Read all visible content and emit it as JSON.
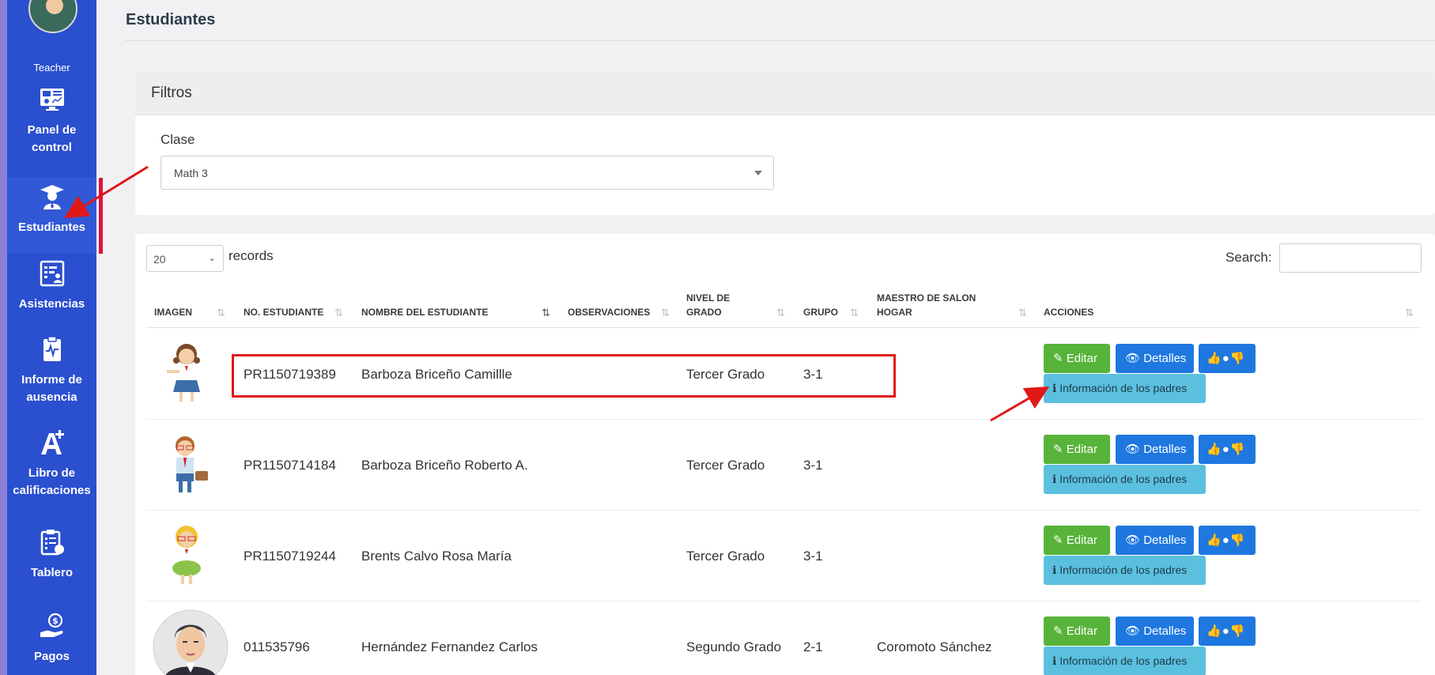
{
  "sidebar": {
    "items": [
      {
        "label": "Teacher",
        "icon": "teacher-avatar"
      },
      {
        "label": "Panel de control",
        "icon": "dashboard-monitor-icon"
      },
      {
        "label": "Estudiantes",
        "icon": "graduate-icon"
      },
      {
        "label": "Asistencias",
        "icon": "attendance-icon"
      },
      {
        "label": "Informe de ausencia",
        "icon": "clipboard-pulse-icon"
      },
      {
        "label": "Libro de calificaciones",
        "icon": "grade-a-plus-icon"
      },
      {
        "label": "Tablero",
        "icon": "board-clipboard-icon"
      },
      {
        "label": "Pagos",
        "icon": "payment-hand-icon"
      }
    ],
    "colors": {
      "background": "#2a4fcf",
      "active_bar": "#e0123a"
    }
  },
  "page": {
    "title": "Estudiantes"
  },
  "filters": {
    "heading": "Filtros",
    "clase_label": "Clase",
    "clase_value": "Math 3"
  },
  "table": {
    "page_length": "20",
    "records_label": "records",
    "search_label": "Search:",
    "search_value": "",
    "columns": [
      "IMAGEN",
      "NO. ESTUDIANTE",
      "NOMBRE DEL ESTUDIANTE",
      "OBSERVACIONES",
      "NIVEL DE GRADO",
      "GRUPO",
      "MAESTRO DE SALON HOGAR",
      "ACCIONES"
    ],
    "rows": [
      {
        "id": "PR1150719389",
        "name": "Barboza Briceño Camillle",
        "observaciones": "",
        "grade": "Tercer Grado",
        "group": "3-1",
        "teacher": ""
      },
      {
        "id": "PR1150714184",
        "name": "Barboza Briceño Roberto A.",
        "observaciones": "",
        "grade": "Tercer Grado",
        "group": "3-1",
        "teacher": ""
      },
      {
        "id": "PR1150719244",
        "name": "Brents Calvo Rosa María",
        "observaciones": "",
        "grade": "Tercer Grado",
        "group": "3-1",
        "teacher": ""
      },
      {
        "id": "011535796",
        "name": "Hernández Fernandez Carlos",
        "observaciones": "",
        "grade": "Segundo Grado",
        "group": "2-1",
        "teacher": "Coromoto Sánchez"
      }
    ],
    "actions": {
      "edit": "Editar",
      "details": "Detalles",
      "parents": "Información de los padres"
    }
  },
  "colors": {
    "edit": "#57b33a",
    "details": "#1e78e0",
    "info": "#5bc0de",
    "annotation": "#e01818"
  }
}
